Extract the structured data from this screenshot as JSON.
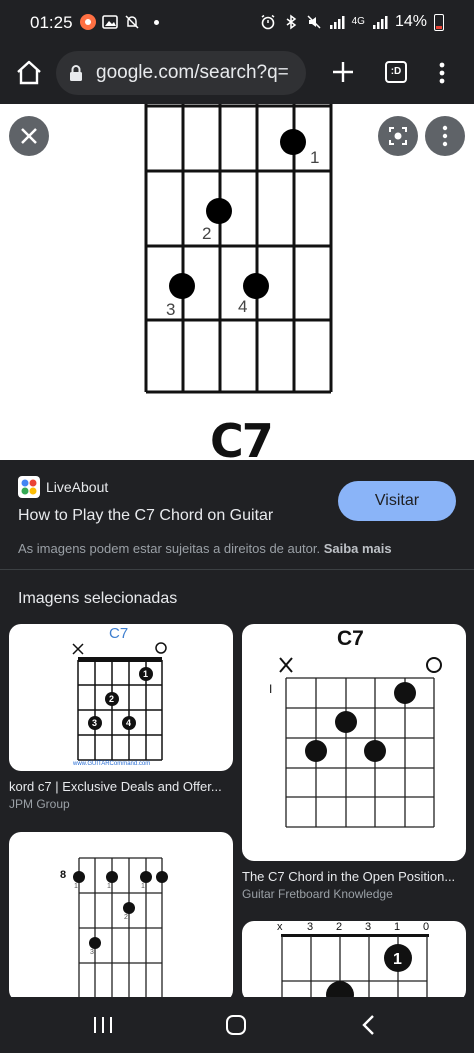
{
  "status_bar": {
    "time": "01:25",
    "network": "4G",
    "battery": "14%"
  },
  "browser": {
    "url": "google.com/search?q=",
    "tab_icon_label": ":D"
  },
  "preview": {
    "chord_name": "C7",
    "finger_labels": [
      "1",
      "2",
      "3",
      "4"
    ]
  },
  "source": {
    "name": "LiveAbout",
    "title": "How to Play the C7 Chord on Guitar",
    "visit_label": "Visitar",
    "copyright_text": "As imagens podem estar sujeitas a direitos de autor.",
    "learn_more": "Saiba mais"
  },
  "related": {
    "section_title": "Imagens selecionadas",
    "cards": [
      {
        "title": "kord c7 | Exclusive Deals and Offer...",
        "source": "JPM Group",
        "chord_label": "C7",
        "watermark": "www.GUITARCommand.com"
      },
      {
        "title": "The C7 Chord in the Open Position...",
        "source": "Guitar Fretboard Knowledge",
        "chord_label": "C7",
        "fret_marker": "I"
      },
      {
        "title": "",
        "source": "",
        "fret_label": "8",
        "finger_labels": [
          "1",
          "1",
          "1",
          "2",
          "3"
        ]
      },
      {
        "title": "",
        "source": "",
        "top_labels": [
          "x",
          "3",
          "2",
          "3",
          "1",
          "0"
        ]
      }
    ]
  },
  "colors": {
    "background": "#202124",
    "accent": "#8ab4f8",
    "text_primary": "#e8eaed",
    "text_secondary": "#9aa0a6"
  }
}
